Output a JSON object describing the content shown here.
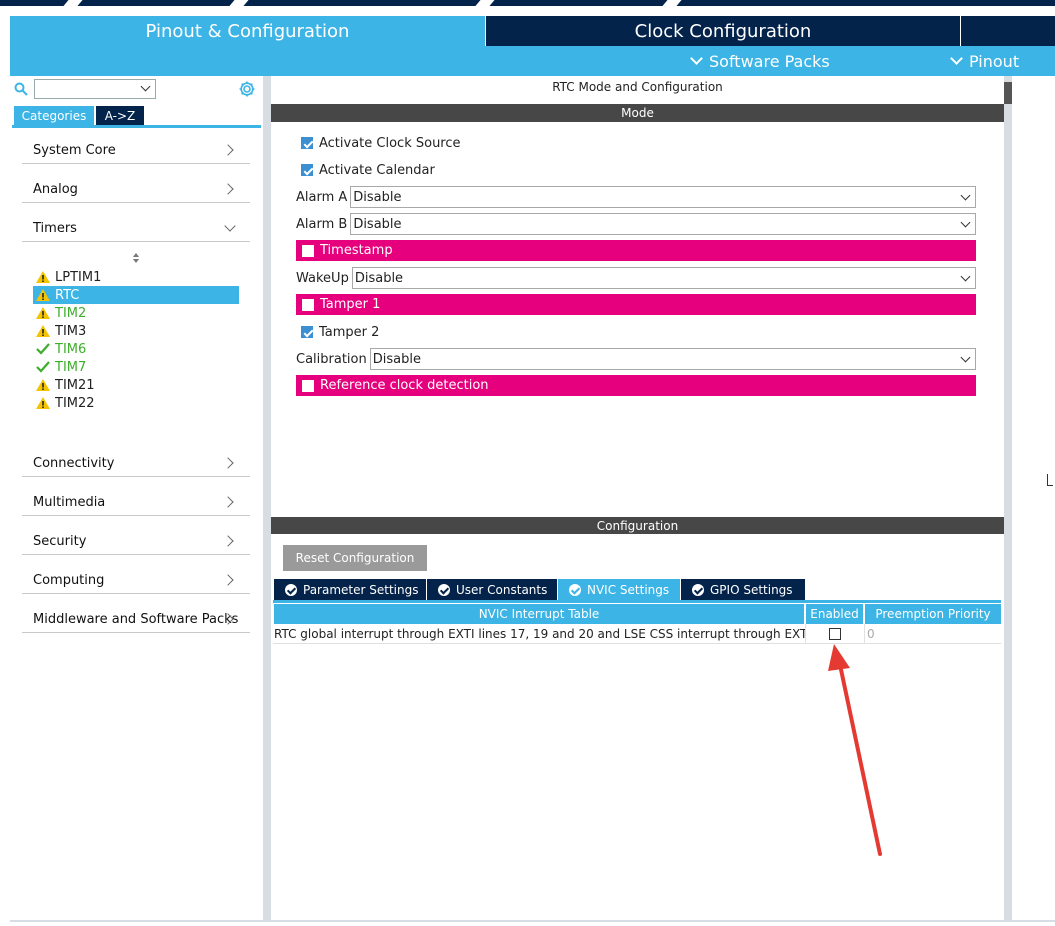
{
  "header": {
    "tabs": [
      {
        "label": "Pinout & Configuration"
      },
      {
        "label": "Clock Configuration"
      }
    ],
    "subbar": {
      "software_packs": "Software Packs",
      "pinout": "Pinout"
    }
  },
  "sidebar": {
    "search_value": "",
    "tabs": {
      "categories": "Categories",
      "az": "A->Z"
    },
    "categories": [
      {
        "label": "System Core"
      },
      {
        "label": "Analog"
      },
      {
        "label": "Timers"
      },
      {
        "label": "Connectivity"
      },
      {
        "label": "Multimedia"
      },
      {
        "label": "Security"
      },
      {
        "label": "Computing"
      },
      {
        "label": "Middleware and Software Packs"
      }
    ],
    "timers": [
      {
        "label": "LPTIM1",
        "status": "warning"
      },
      {
        "label": "RTC",
        "status": "warning"
      },
      {
        "label": "TIM2",
        "status": "warning"
      },
      {
        "label": "TIM3",
        "status": "warning"
      },
      {
        "label": "TIM6",
        "status": "ok"
      },
      {
        "label": "TIM7",
        "status": "ok"
      },
      {
        "label": "TIM21",
        "status": "warning"
      },
      {
        "label": "TIM22",
        "status": "warning"
      }
    ]
  },
  "mode": {
    "title": "RTC Mode and Configuration",
    "section": "Mode",
    "activate_clock_source": "Activate Clock Source",
    "activate_calendar": "Activate Calendar",
    "alarm_a": {
      "label": "Alarm A",
      "value": "Disable"
    },
    "alarm_b": {
      "label": "Alarm B",
      "value": "Disable"
    },
    "timestamp": "Timestamp",
    "wakeup": {
      "label": "WakeUp",
      "value": "Disable"
    },
    "tamper1": "Tamper 1",
    "tamper2": "Tamper 2",
    "calibration": {
      "label": "Calibration",
      "value": "Disable"
    },
    "reference_clock": "Reference clock detection"
  },
  "config": {
    "section": "Configuration",
    "reset_button": "Reset Configuration",
    "tabs": [
      {
        "label": "Parameter Settings"
      },
      {
        "label": "User Constants"
      },
      {
        "label": "NVIC Settings"
      },
      {
        "label": "GPIO Settings"
      }
    ],
    "table": {
      "headers": [
        "NVIC Interrupt Table",
        "Enabled",
        "Preemption Priority"
      ],
      "rows": [
        {
          "name": "RTC global interrupt through EXTI lines 17, 19 and 20 and LSE CSS interrupt through EXT...",
          "enabled": false,
          "priority": "0"
        }
      ]
    }
  },
  "colors": {
    "accent": "#3cb4e6",
    "dark": "#03234b",
    "pink": "#e6007e",
    "section_bar": "#474747",
    "arrow": "#e53a32"
  }
}
